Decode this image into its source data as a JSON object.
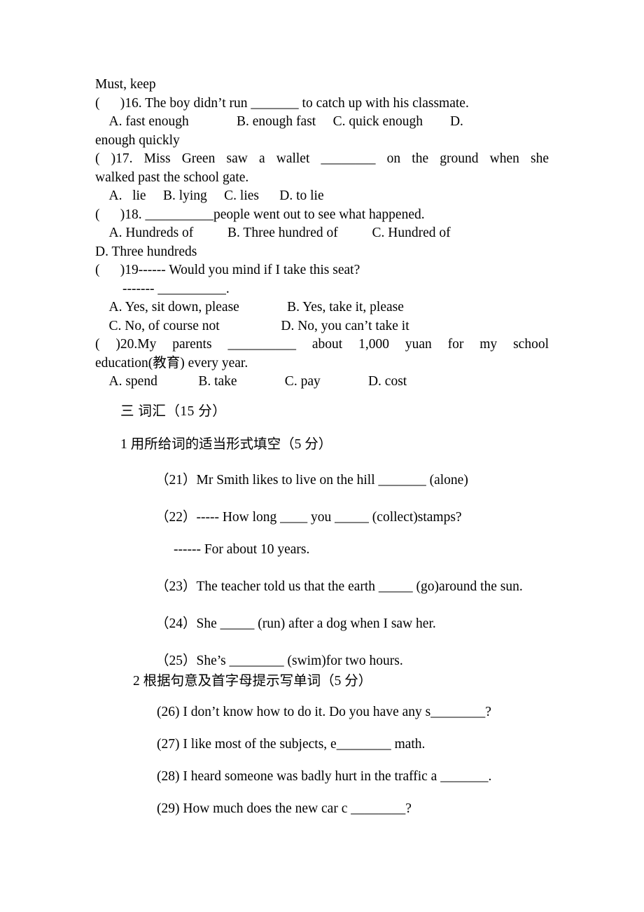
{
  "document": {
    "type": "english-exam-worksheet",
    "language": "en-zh",
    "text_color": "#000000",
    "background_color": "#ffffff"
  },
  "partA": {
    "carryover_line": "Must, keep",
    "questions": [
      {
        "stem": "(      )16. The boy didn’t run _______ to catch up with his classmate.",
        "options_line1": "    A. fast enough              B. enough fast     C. quick enough        D.",
        "options_line2": "enough quickly"
      },
      {
        "stem_justified": "(      )17. Miss Green saw a wallet ________ on the ground when she",
        "stem_line2": "walked past the school gate.",
        "options_line1": "    A.   lie     B. lying     C. lies      D. to lie"
      },
      {
        "stem": "(      )18. __________people went out to see what happened.",
        "options_line1": "    A. Hundreds of          B. Three hundred of          C. Hundred of",
        "options_line2": "D. Three hundreds"
      },
      {
        "stem": "(      )19------ Would you mind if I take this seat?",
        "stem_line2": "        ------- __________.",
        "options_line1": "    A. Yes, sit down, please              B. Yes, take it, please",
        "options_line2": "    C. No, of course not                  D. No, you can’t take it"
      },
      {
        "stem_justified": "(      )20.My parents __________ about 1,000 yuan for my school",
        "stem_line2": "education(教育) every year.",
        "options_line1": "    A. spend            B. take              C. pay              D. cost"
      }
    ]
  },
  "section_heading": "三  词汇（15 分）",
  "sub_section_1": {
    "heading": "1 用所给词的适当形式填空（5 分）",
    "questions": [
      "（21）Mr Smith likes to live on the hill _______ (alone)",
      "（22）----- How long ____ you _____ (collect)stamps?",
      "------ For about 10 years.",
      "（23）The teacher told us that the earth _____ (go)around the sun.",
      "（24）She _____ (run) after a dog when I saw her.",
      "（25）She’s ________ (swim)for two hours."
    ]
  },
  "sub_section_2": {
    "heading": "2  根据句意及首字母提示写单词（5 分）",
    "questions": [
      "(26) I don’t know how to do it. Do you have any s________?",
      "(27) I like most of the subjects, e________ math.",
      "(28) I heard someone was badly hurt in the traffic a _______.",
      "(29) How much does the new car c ________?"
    ]
  }
}
